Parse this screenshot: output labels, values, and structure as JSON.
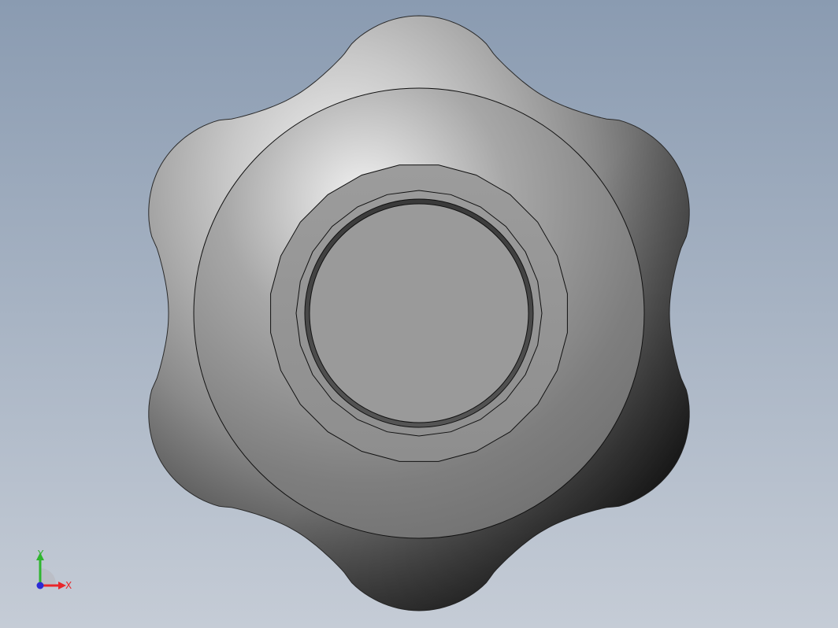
{
  "viewport": {
    "background_top": "#8a9bb1",
    "background_bottom": "#c5ccd6"
  },
  "part": {
    "shape": "six-lobed star knob, top view",
    "lobe_count": 6,
    "body_color_light": "#f2f2f2",
    "body_color_mid": "#8e8e8e",
    "body_color_dark": "#111111",
    "face_color": "#9a9a9a",
    "edge_color": "#111111"
  },
  "triad": {
    "x_label": "X",
    "y_label": "Y",
    "x_color": "#e8262a",
    "y_color": "#2fb52f",
    "z_color": "#2b2bd6"
  }
}
